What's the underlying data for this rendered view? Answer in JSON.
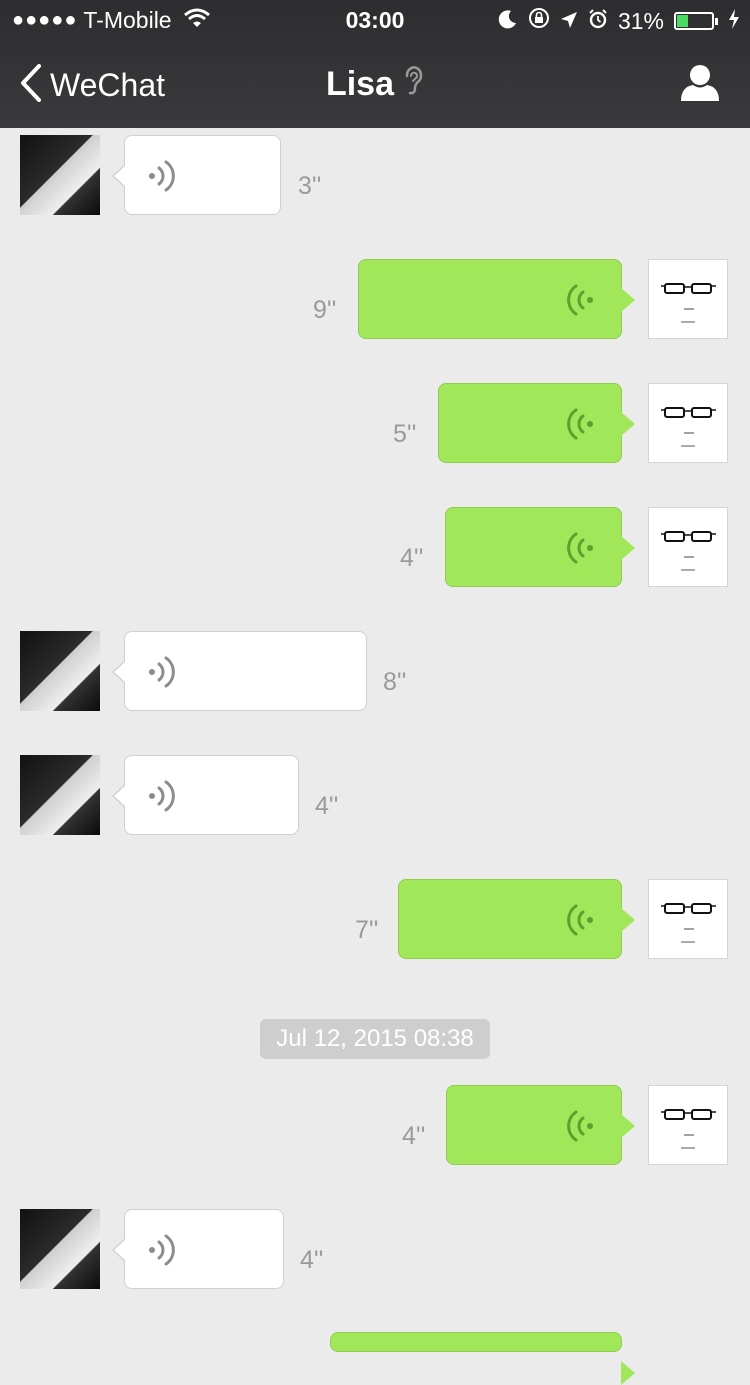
{
  "status_bar": {
    "signal": "●●●●●",
    "carrier": "T-Mobile",
    "time": "03:00",
    "battery": "31%",
    "battery_level": 0.31,
    "battery_color": "#4cd964"
  },
  "nav": {
    "back_label": "WeChat",
    "title": "Lisa",
    "icons": [
      "back-chevron-icon",
      "earpiece-mode-icon",
      "profile-icon"
    ]
  },
  "colors": {
    "outgoing_bubble": "#a0e75a",
    "incoming_bubble": "#ffffff",
    "background": "#ebebeb"
  },
  "messages": [
    {
      "sender": "Lisa",
      "type": "voice",
      "duration": "3''"
    },
    {
      "sender": "me",
      "type": "voice",
      "duration": "9''"
    },
    {
      "sender": "me",
      "type": "voice",
      "duration": "5''"
    },
    {
      "sender": "me",
      "type": "voice",
      "duration": "4''"
    },
    {
      "sender": "Lisa",
      "type": "voice",
      "duration": "8''"
    },
    {
      "sender": "Lisa",
      "type": "voice",
      "duration": "4''"
    },
    {
      "sender": "me",
      "type": "voice",
      "duration": "7''"
    },
    {
      "type": "timestamp",
      "text": "Jul 12, 2015 08:38"
    },
    {
      "sender": "me",
      "type": "voice",
      "duration": "4''"
    },
    {
      "sender": "Lisa",
      "type": "voice",
      "duration": "4''"
    }
  ]
}
